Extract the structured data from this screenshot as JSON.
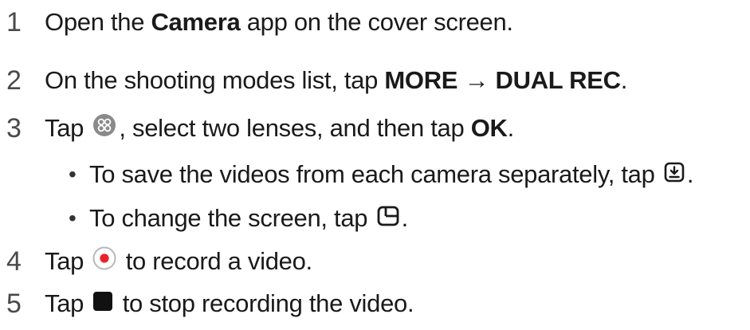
{
  "steps": [
    {
      "number": "1",
      "pre": "Open the ",
      "bold": "Camera",
      "post": " app on the cover screen."
    },
    {
      "number": "2",
      "pre": "On the shooting modes list, tap ",
      "bold1": "MORE",
      "arrow": " → ",
      "bold2": "DUAL REC",
      "post": "."
    },
    {
      "number": "3",
      "pre": "Tap ",
      "icon": "lens-select-icon",
      "mid": ", select two lenses, and then tap ",
      "bold": "OK",
      "post": ".",
      "bullets": [
        {
          "text": "To save the videos from each camera separately, tap ",
          "icon": "save-separately-icon",
          "post": "."
        },
        {
          "text": "To change the screen, tap ",
          "icon": "change-screen-icon",
          "post": "."
        }
      ]
    },
    {
      "number": "4",
      "pre": "Tap ",
      "icon": "record-icon",
      "post": " to record a video."
    },
    {
      "number": "5",
      "pre": "Tap ",
      "icon": "stop-icon",
      "post": " to stop recording the video."
    }
  ],
  "bullet_char": "•",
  "colors": {
    "text": "#1a1a1a",
    "number": "#4a4a4a",
    "record_red": "#e8232a",
    "icon_gray": "#8a8a8a"
  }
}
